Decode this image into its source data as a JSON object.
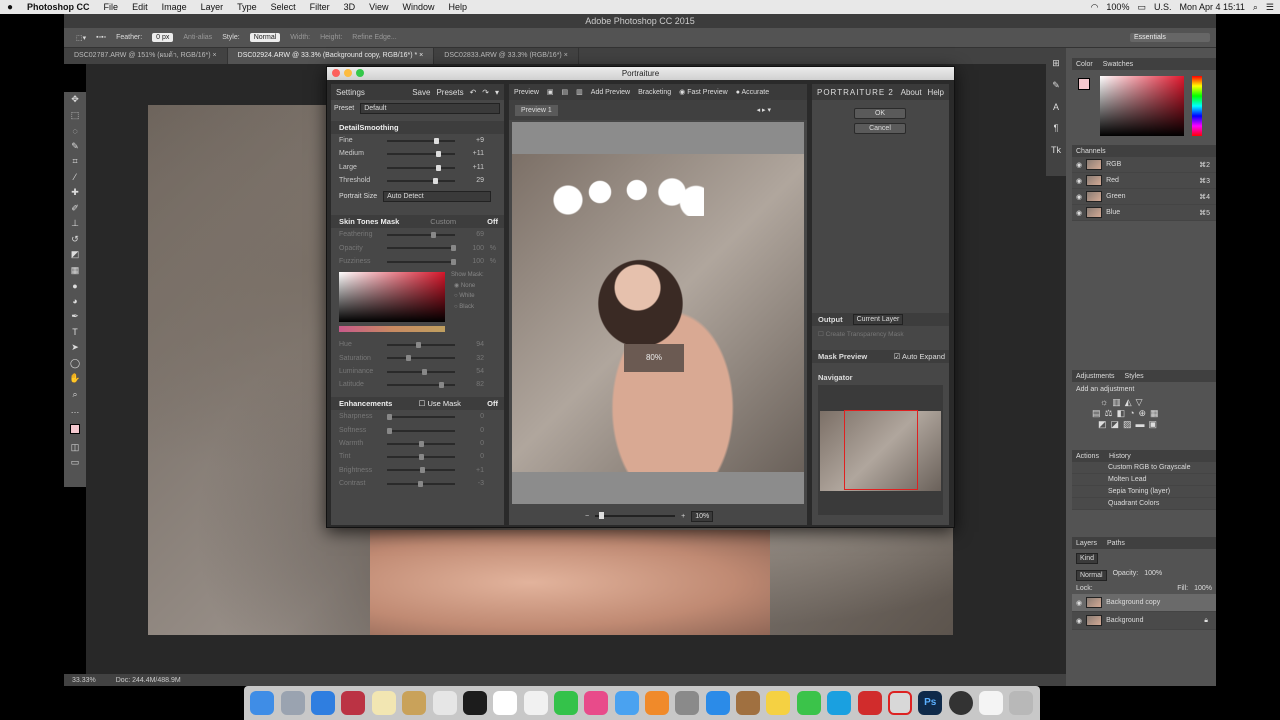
{
  "menubar": {
    "apple": "",
    "app": "Photoshop CC",
    "items": [
      "File",
      "Edit",
      "Image",
      "Layer",
      "Type",
      "Select",
      "Filter",
      "3D",
      "View",
      "Window",
      "Help"
    ],
    "status": {
      "battery": "100%",
      "input": "U.S.",
      "datetime": "Mon Apr 4  15:11"
    }
  },
  "ps": {
    "title": "Adobe Photoshop CC 2015",
    "options": {
      "feather_label": "Feather:",
      "feather": "0 px",
      "antialias": "Anti-alias",
      "style_label": "Style:",
      "style": "Normal",
      "width": "Width:",
      "height": "Height:",
      "refine": "Refine Edge...",
      "workspace": "Essentials"
    },
    "tabs": [
      "DSC02787.ARW @ 151% (ผมด้า, RGB/16*) ×",
      "DSC02924.ARW @ 33.3% (Background copy, RGB/16*) * ×",
      "DSC02833.ARW @ 33.3% (RGB/16*) ×"
    ],
    "status": {
      "zoom": "33.33%",
      "doc": "Doc: 244.4M/488.9M"
    }
  },
  "portraiture": {
    "title": "Portraiture",
    "settings": {
      "header": "Settings",
      "save": "Save",
      "presets": "Presets",
      "preset_label": "Preset",
      "preset": "Default",
      "detail_title": "DetailSmoothing",
      "detail": [
        {
          "label": "Fine",
          "value": "+9",
          "pos": 0.73
        },
        {
          "label": "Medium",
          "value": "+11",
          "pos": 0.77
        },
        {
          "label": "Large",
          "value": "+11",
          "pos": 0.77
        },
        {
          "label": "Threshold",
          "value": "29",
          "pos": 0.72
        }
      ],
      "portrait_size_label": "Portrait Size",
      "portrait_size": "Auto Detect",
      "skin_title": "Skin Tones Mask",
      "skin_mode": "Custom",
      "skin_off": "Off",
      "skin": [
        {
          "label": "Feathering",
          "value": "69",
          "unit": "",
          "pos": 0.69
        },
        {
          "label": "Opacity",
          "value": "100",
          "unit": "%",
          "pos": 1.0
        },
        {
          "label": "Fuzziness",
          "value": "100",
          "unit": "%",
          "pos": 1.0
        }
      ],
      "show_mask": "Show Mask:",
      "mask_opts": [
        "None",
        "White",
        "Black"
      ],
      "hsl": [
        {
          "label": "Hue",
          "value": "94",
          "pos": 0.45
        },
        {
          "label": "Saturation",
          "value": "32",
          "pos": 0.3
        },
        {
          "label": "Luminance",
          "value": "54",
          "pos": 0.55
        },
        {
          "label": "Latitude",
          "value": "82",
          "pos": 0.82
        }
      ],
      "enh_title": "Enhancements",
      "use_mask": "Use Mask",
      "enh_off": "Off",
      "enh": [
        {
          "label": "Sharpness",
          "value": "0",
          "pos": 0.0
        },
        {
          "label": "Softness",
          "value": "0",
          "pos": 0.0
        },
        {
          "label": "Warmth",
          "value": "0",
          "pos": 0.5
        },
        {
          "label": "Tint",
          "value": "0",
          "pos": 0.5
        },
        {
          "label": "Brightness",
          "value": "+1",
          "pos": 0.52
        },
        {
          "label": "Contrast",
          "value": "-3",
          "pos": 0.48
        }
      ]
    },
    "preview": {
      "header": "Preview",
      "add": "Add Preview",
      "bracketing": "Bracketing",
      "fast": "Fast Preview",
      "accurate": "Accurate",
      "tab": "Preview 1",
      "badge": "80%",
      "zoom": "10%"
    },
    "right": {
      "logo": "PORTRAITURE 2",
      "about": "About",
      "help": "Help",
      "ok": "OK",
      "cancel": "Cancel",
      "output": "Output",
      "output_val": "Current Layer",
      "create_mask": "Create Transparency Mask",
      "mask_preview": "Mask Preview",
      "auto_expand": "Auto Expand",
      "navigator": "Navigator"
    }
  },
  "panels": {
    "color_tabs": [
      "Color",
      "Swatches"
    ],
    "channels_title": "Channels",
    "channels": [
      {
        "name": "RGB",
        "key": "⌘2"
      },
      {
        "name": "Red",
        "key": "⌘3"
      },
      {
        "name": "Green",
        "key": "⌘4"
      },
      {
        "name": "Blue",
        "key": "⌘5"
      }
    ],
    "adj_tabs": [
      "Adjustments",
      "Styles"
    ],
    "adj_add": "Add an adjustment",
    "actions_tabs": [
      "Actions",
      "History"
    ],
    "actions": [
      "Custom RGB to Grayscale",
      "Molten Lead",
      "Sepia Toning (layer)",
      "Quadrant Colors"
    ],
    "layers_tabs": [
      "Layers",
      "Paths"
    ],
    "kind": "Kind",
    "blend": "Normal",
    "opacity_label": "Opacity:",
    "opacity": "100%",
    "lock": "Lock:",
    "fill_label": "Fill:",
    "fill": "100%",
    "layers": [
      "Background copy",
      "Background"
    ]
  }
}
